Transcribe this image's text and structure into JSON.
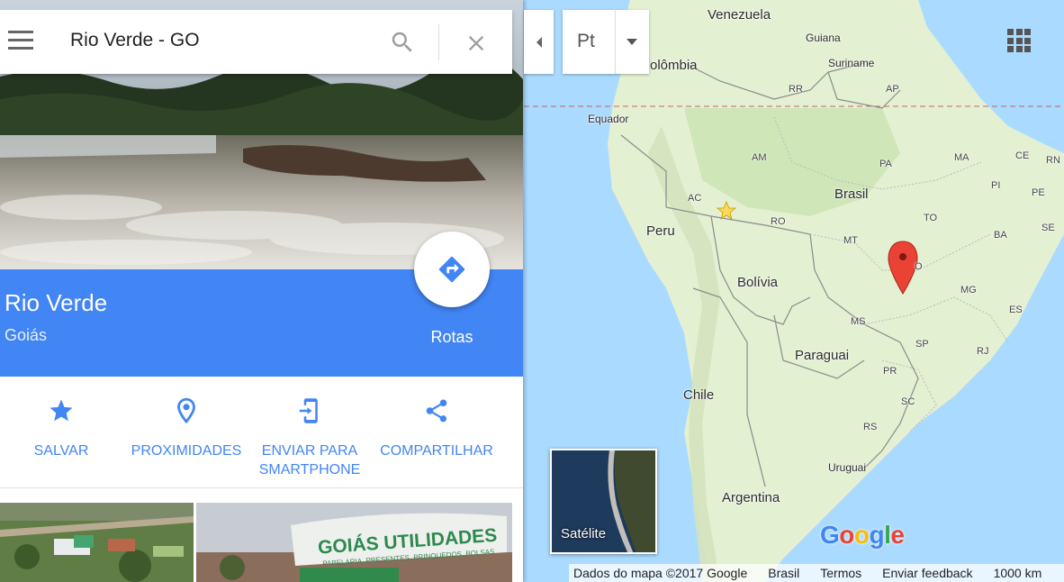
{
  "search": {
    "value": "Rio Verde - GO",
    "menu_icon": "hamburger-menu-icon",
    "search_icon": "search-icon",
    "close_icon": "close-icon"
  },
  "place": {
    "title": "Rio Verde",
    "subtitle": "Goiás",
    "route_label": "Rotas",
    "route_icon": "directions-icon"
  },
  "actions": [
    {
      "label": "SALVAR",
      "icon": "star-icon"
    },
    {
      "label": "PROXIMIDADES",
      "icon": "nearby-pin-icon"
    },
    {
      "label": "ENVIAR PARA\nSMARTPHONE",
      "icon": "send-to-phone-icon"
    },
    {
      "label": "COMPARTILHAR",
      "icon": "share-icon"
    }
  ],
  "photos": [
    {
      "icon": "aerial-photo-thumbnail"
    },
    {
      "text": "GOIÁS UTILIDADES",
      "subtext": "PAPELARIA, PRESENTES, BRINQUEDOS, BOLSAS"
    }
  ],
  "map_controls": {
    "language": "Pt",
    "apps_icon": "apps-grid-icon",
    "collapse_icon": "collapse-panel-icon",
    "layer_thumbnail_label": "Satélite"
  },
  "map_labels": {
    "countries": {
      "venezuela": "Venezuela",
      "guiana": "Guiana",
      "suriname": "Suriname",
      "colombia": "olômbia",
      "equador": "Equador",
      "peru": "Peru",
      "brasil": "Brasil",
      "bolivia": "Bolívia",
      "paraguai": "Paraguai",
      "chile": "Chile",
      "argentina": "Argentina",
      "uruguai": "Uruguai"
    },
    "states": {
      "rr": "RR",
      "ap": "AP",
      "am": "AM",
      "pa": "PA",
      "ma": "MA",
      "ce": "CE",
      "rn": "RN",
      "pi": "PI",
      "pe": "PE",
      "se": "SE",
      "ac": "AC",
      "ro": "RO",
      "to": "TO",
      "ba": "BA",
      "mt": "MT",
      "go": "O",
      "mg": "MG",
      "ms": "MS",
      "es": "ES",
      "sp": "SP",
      "rj": "RJ",
      "pr": "PR",
      "sc": "SC",
      "rs": "RS"
    },
    "marker_icon": "location-pin-icon",
    "capital_icon": "capital-star-icon"
  },
  "logo": "Google",
  "footer": {
    "map_data": "Dados do mapa ©2017 Google",
    "country": "Brasil",
    "terms": "Termos",
    "feedback": "Enviar feedback",
    "scale": "1000 km"
  },
  "colors": {
    "accent_blue": "#4285f4",
    "water": "#aadaff",
    "land": "#e4f0d2",
    "marker_red": "#ea4335"
  }
}
